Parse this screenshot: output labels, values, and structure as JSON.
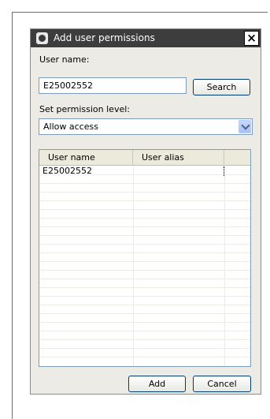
{
  "window": {
    "title": "Add user permissions",
    "close_label": "×"
  },
  "form": {
    "username_label": "User name:",
    "username_value": "E25002552",
    "search_label": "Search",
    "permission_label": "Set permission level:",
    "permission_selected": "Allow access"
  },
  "table": {
    "columns": [
      "User name",
      "User alias"
    ],
    "rows": [
      {
        "user_name": "E25002552",
        "user_alias": ""
      }
    ]
  },
  "footer": {
    "add_label": "Add",
    "cancel_label": "Cancel"
  },
  "colors": {
    "titlebar": "#3d3d3d",
    "dialog_bg": "#ecebe6",
    "field_border": "#7f9db9",
    "button_border": "#003c74"
  },
  "icons": {
    "title": "app-icon",
    "close": "close-icon",
    "dropdown": "chevron-down-icon"
  }
}
